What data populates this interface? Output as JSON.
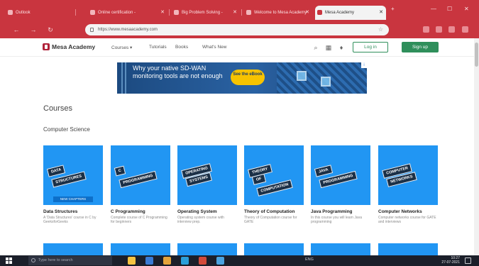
{
  "browser": {
    "tabs": [
      {
        "label": "Outlook",
        "active": false
      },
      {
        "label": "Online certification - ",
        "active": false
      },
      {
        "label": "Big Problem Solving - ",
        "active": false
      },
      {
        "label": "Welcome to Mesa Academy",
        "active": false
      },
      {
        "label": "Mesa Academy",
        "active": true
      }
    ],
    "new_tab_label": "+",
    "url": "https://www.mesaacademy.com",
    "colors": {
      "chrome": "#c9353f",
      "active_tab": "#f3f3f3"
    }
  },
  "site": {
    "logo_text": "Mesa Academy",
    "nav": {
      "courses": "Courses ▾",
      "tutorials": "Tutorials",
      "books": "Books",
      "whats_new": "What's New"
    },
    "login_label": "Log in",
    "signup_label": "Sign up",
    "colors": {
      "brand": "#b0223a",
      "accent_green": "#2f8f5b",
      "card_blue": "#2196f3"
    }
  },
  "ad": {
    "headline": "Why your native SD-WAN monitoring tools are not enough",
    "cta": "See the eBook",
    "close_glyph": "i"
  },
  "content": {
    "heading": "Courses",
    "section_title": "Computer Science",
    "cards": [
      {
        "tags": [
          "DATA",
          "STRUCTURES",
          ""
        ],
        "ribbon": "NEW CHAPTERS",
        "title": "Data Structures",
        "description": "A 'Data Structures' course in C by GeeksforGeeks"
      },
      {
        "tags": [
          "C",
          "PROGRAMMING",
          ""
        ],
        "ribbon": "",
        "title": "C Programming",
        "description": "Complete course of C Programming for beginners"
      },
      {
        "tags": [
          "OPERATING",
          "SYSTEMS",
          ""
        ],
        "ribbon": "",
        "title": "Operating System",
        "description": "Operating system course with interview prep."
      },
      {
        "tags": [
          "THEORY",
          "OF",
          "COMPUTATION"
        ],
        "ribbon": "",
        "title": "Theory of Computation",
        "description": "Theory of Computation course for GATE"
      },
      {
        "tags": [
          "JAVA",
          "PROGRAMMING",
          ""
        ],
        "ribbon": "",
        "title": "Java Programming",
        "description": "In this course you will learn Java programming"
      },
      {
        "tags": [
          "COMPUTER",
          "NETWORKS",
          ""
        ],
        "ribbon": "",
        "title": "Computer Networks",
        "description": "Computer networks course for GATE and interviews"
      }
    ]
  },
  "taskbar": {
    "search_placeholder": "Type here to search",
    "tray_text": "ENG",
    "time": "10:27",
    "date": "27-07-2021"
  }
}
